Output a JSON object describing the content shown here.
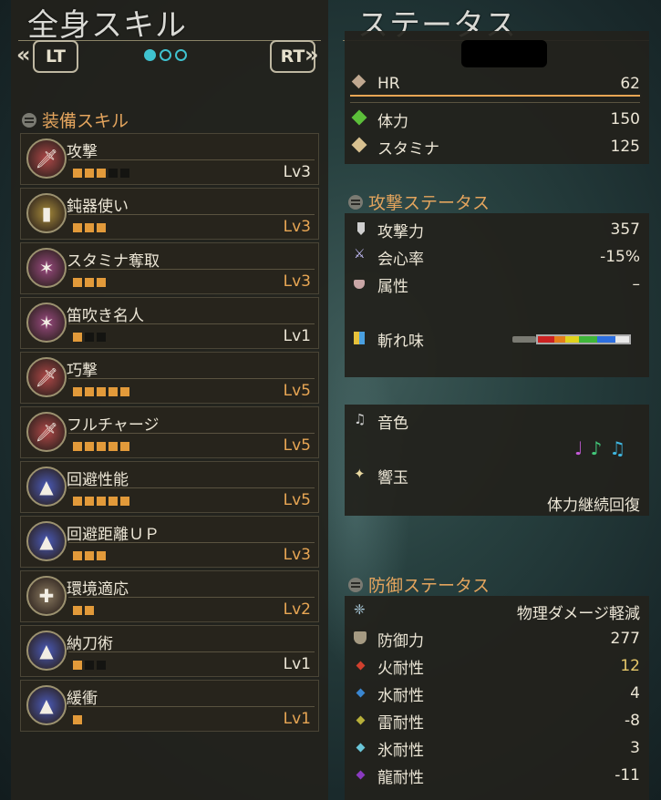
{
  "left": {
    "title": "全身スキル",
    "nav_left": "LT",
    "nav_right": "RT",
    "section": "装備スキル",
    "skills": [
      {
        "name": "攻撃",
        "filled": 3,
        "total": 5,
        "level": "Lv3",
        "max": false,
        "icon": "attack-icon",
        "color": "#b04848"
      },
      {
        "name": "鈍器使い",
        "filled": 3,
        "total": 3,
        "level": "Lv3",
        "max": true,
        "icon": "blunt-icon",
        "color": "#a68a3a"
      },
      {
        "name": "スタミナ奪取",
        "filled": 3,
        "total": 3,
        "level": "Lv3",
        "max": true,
        "icon": "stamina-thief-icon",
        "color": "#9a4a80"
      },
      {
        "name": "笛吹き名人",
        "filled": 1,
        "total": 3,
        "level": "Lv1",
        "max": false,
        "icon": "horn-maestro-icon",
        "color": "#9a4a80"
      },
      {
        "name": "巧撃",
        "filled": 5,
        "total": 5,
        "level": "Lv5",
        "max": true,
        "icon": "adrenaline-icon",
        "color": "#b04848"
      },
      {
        "name": "フルチャージ",
        "filled": 5,
        "total": 5,
        "level": "Lv5",
        "max": true,
        "icon": "full-charge-icon",
        "color": "#b04848"
      },
      {
        "name": "回避性能",
        "filled": 5,
        "total": 5,
        "level": "Lv5",
        "max": true,
        "icon": "evade-icon",
        "color": "#4a5ab8"
      },
      {
        "name": "回避距離ＵＰ",
        "filled": 3,
        "total": 3,
        "level": "Lv3",
        "max": true,
        "icon": "evade-extend-icon",
        "color": "#4a5ab8"
      },
      {
        "name": "環境適応",
        "filled": 2,
        "total": 2,
        "level": "Lv2",
        "max": true,
        "icon": "environment-icon",
        "color": "#8a7a60"
      },
      {
        "name": "納刀術",
        "filled": 1,
        "total": 3,
        "level": "Lv1",
        "max": false,
        "icon": "quick-sheath-icon",
        "color": "#4a5ab8"
      },
      {
        "name": "緩衝",
        "filled": 1,
        "total": 1,
        "level": "Lv1",
        "max": true,
        "icon": "cushion-icon",
        "color": "#4a5ab8"
      }
    ]
  },
  "right": {
    "title": "ステータス",
    "hr_label": "HR",
    "hr_value": "62",
    "health_label": "体力",
    "health_value": "150",
    "stamina_label": "スタミナ",
    "stamina_value": "125",
    "attack_section": "攻撃ステータス",
    "attack_label": "攻撃力",
    "attack_value": "357",
    "affinity_label": "会心率",
    "affinity_value": "-15%",
    "element_label": "属性",
    "element_value": "–",
    "sharpness_label": "斬れ味",
    "melody_label": "音色",
    "echo_label": "響玉",
    "echo_value": "体力継続回復",
    "defense_section": "防御ステータス",
    "defense_buff": "物理ダメージ軽減",
    "defense_label": "防御力",
    "defense_value": "277",
    "fire_label": "火耐性",
    "fire_value": "12",
    "water_label": "水耐性",
    "water_value": "4",
    "thunder_label": "雷耐性",
    "thunder_value": "-8",
    "ice_label": "氷耐性",
    "ice_value": "3",
    "dragon_label": "龍耐性",
    "dragon_value": "-11"
  }
}
